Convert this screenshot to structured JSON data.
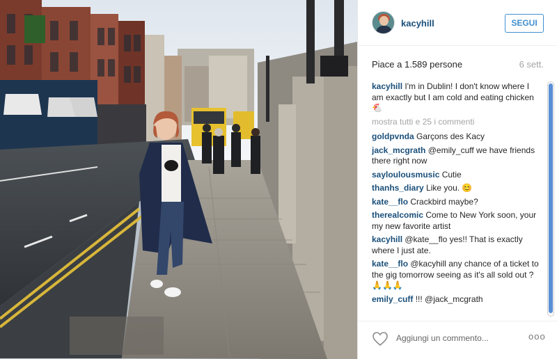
{
  "photo": {
    "alt_scene": "street-photo"
  },
  "header": {
    "username": "kacyhill",
    "follow_label": "SEGUI"
  },
  "stats": {
    "likes": "Piace a 1.589 persone",
    "time": "6 sett."
  },
  "caption": {
    "user": "kacyhill",
    "text": "I'm in Dublin! I don't know where I am exactly but I am cold and eating chicken 🐔"
  },
  "show_all_label": "mostra tutti e 25 i commenti",
  "comments": [
    {
      "user": "goldpvnda",
      "text": "Garçons des Kacy"
    },
    {
      "user": "jack_mcgrath",
      "text": "@emily_cuff we have friends there right now"
    },
    {
      "user": "sayloulousmusic",
      "text": "Cutie"
    },
    {
      "user": "thanhs_diary",
      "text": "Like you. 😊"
    },
    {
      "user": "kate__flo",
      "text": "Crackbird maybe?"
    },
    {
      "user": "therealcomic",
      "text": "Come to New York soon, your my new favorite artist"
    },
    {
      "user": "kacyhill",
      "text": "@kate__flo yes!! That is exactly where I just ate."
    },
    {
      "user": "kate__flo",
      "text": "@kacyhill any chance of a ticket to the gig tomorrow seeing as it's all sold out ? 🙏🙏🙏"
    },
    {
      "user": "emily_cuff",
      "text": "!!! @jack_mcgrath"
    }
  ],
  "footer": {
    "comment_placeholder": "Aggiungi un commento...",
    "more_label": "ooo"
  },
  "icons": {
    "like": "heart-icon",
    "options": "more-options-icon"
  },
  "colors": {
    "username_blue": "#1a4f7a",
    "follow_blue": "#3f8fd0",
    "scroll_thumb": "#5b8fd6"
  }
}
